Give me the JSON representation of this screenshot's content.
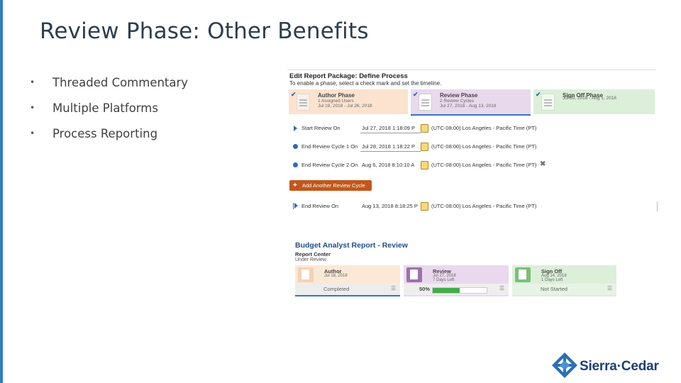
{
  "slide": {
    "title": "Review Phase: Other Benefits",
    "accent_color": "#2f7fc1",
    "bullets": [
      "Threaded Commentary",
      "Multiple Platforms",
      "Process Reporting"
    ]
  },
  "define_process": {
    "title": "Edit Report Package: Define Process",
    "subtitle": "To enable a phase, select a check mark and set the timeline.",
    "phases": [
      {
        "name": "Author Phase",
        "line1": "1 Assigned Users",
        "line2": "Jul 19, 2018 - Jul 26, 2018",
        "check_icon": "check-icon",
        "color": "#fbe3cf"
      },
      {
        "name": "Review Phase",
        "line1": "2 Review Cycles",
        "line2": "Jul 27, 2018 - Aug 13, 2018",
        "check_icon": "check-icon",
        "color": "#e9d9ec"
      },
      {
        "name": "Sign Off Phase",
        "line1": "Jul 30, 2018 - Aug 1, 2018",
        "line2": "",
        "check_icon": "check-icon",
        "color": "#dcefd9"
      }
    ],
    "milestones": [
      {
        "label": "Start Review On",
        "date": "Jul 27, 2018 1:18:09 P",
        "timezone": "(UTC-08:00) Los Angeles - Pacific Time (PT)",
        "marker": "triangle"
      },
      {
        "label": "End Review Cycle 1 On",
        "date": "Jul 28, 2018 1:18:22 P",
        "timezone": "(UTC-08:00) Los Angeles - Pacific Time (PT)",
        "marker": "circle"
      },
      {
        "label": "End Review Cycle 2 On",
        "date": "Aug 6, 2018 8:10:10 A",
        "timezone": "(UTC-08:00) Los Angeles - Pacific Time (PT)",
        "marker": "circle",
        "delete_glyph": "✖"
      },
      {
        "label": "End Review On",
        "date": "Aug 13, 2018 8:18:25 P",
        "timezone": "(UTC-08:00) Los Angeles - Pacific Time (PT)",
        "marker": "end"
      }
    ],
    "add_button": {
      "label": "Add Another Review Cycle",
      "icon": "+",
      "color": "#c2571b"
    }
  },
  "status_panel": {
    "title": "Budget Analyst Report - Review",
    "subtitle": "Report Center",
    "status_line": "Under Review",
    "cards": [
      {
        "name": "Author",
        "line1": "Jul 18, 2018",
        "line2": "",
        "status": "Completed",
        "menu": "☰"
      },
      {
        "name": "Review",
        "line1": "Jul 27, 2018",
        "line2": "7 Days Left",
        "percent_label": "50%",
        "progress": 0.5,
        "menu": "☰"
      },
      {
        "name": "Sign Off",
        "line1": "Aug 14, 2018",
        "line2": "1 Days Left",
        "status": "Not Started",
        "menu": "☰"
      }
    ]
  },
  "logo": {
    "text": "Sierra·Cedar",
    "color": "#1c3f73"
  }
}
